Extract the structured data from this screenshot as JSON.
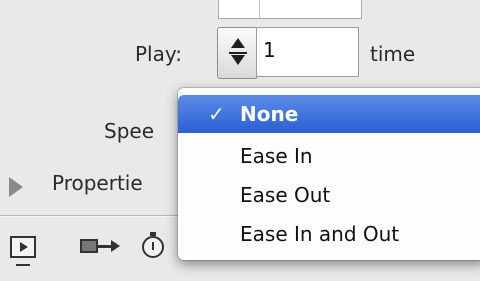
{
  "form": {
    "play_label": "Play:",
    "play_value": "1",
    "time_label": "time",
    "speed_label": "Spee",
    "properties_label": "Propertie"
  },
  "menu": {
    "items": [
      {
        "label": "None",
        "selected": true,
        "check": "✓"
      },
      {
        "label": "Ease In",
        "selected": false
      },
      {
        "label": "Ease Out",
        "selected": false
      },
      {
        "label": "Ease In and Out",
        "selected": false
      }
    ],
    "accent_color": "#3a6fdc"
  },
  "toolbar": {
    "icons": [
      "screen-play-icon",
      "move-arrow-icon",
      "timer-icon"
    ]
  }
}
